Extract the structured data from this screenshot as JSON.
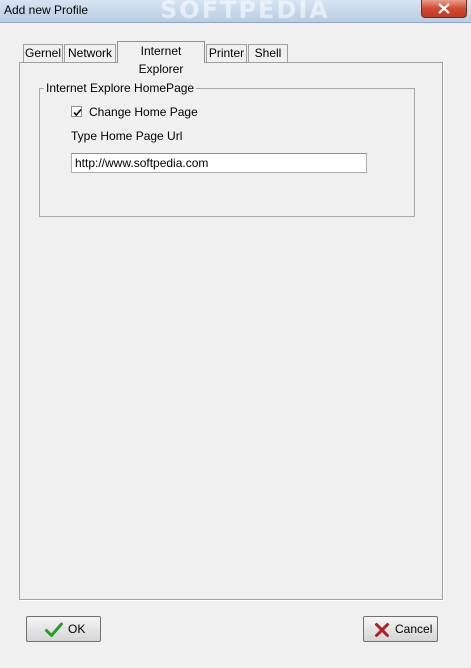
{
  "window": {
    "title": "Add new Profile",
    "watermark": "SOFTPEDIA"
  },
  "tabs": [
    {
      "label": "Gernel",
      "active": false
    },
    {
      "label": "Network",
      "active": false
    },
    {
      "label": "Internet Explorer",
      "active": true
    },
    {
      "label": "Printer",
      "active": false
    },
    {
      "label": "Shell",
      "active": false
    }
  ],
  "homepage_group": {
    "title": "Internet Explore HomePage",
    "checkbox_label": "Change Home Page",
    "checkbox_checked": true,
    "url_label": "Type Home Page Url",
    "url_value": "http://www.softpedia.com"
  },
  "buttons": {
    "ok_label": "OK",
    "ok_icon": "checkmark-icon",
    "cancel_label": "Cancel",
    "cancel_icon": "x-icon"
  },
  "colors": {
    "ok_check": "#2a9a2a",
    "cancel_x": "#b02020",
    "close_button": "#c9432b"
  }
}
